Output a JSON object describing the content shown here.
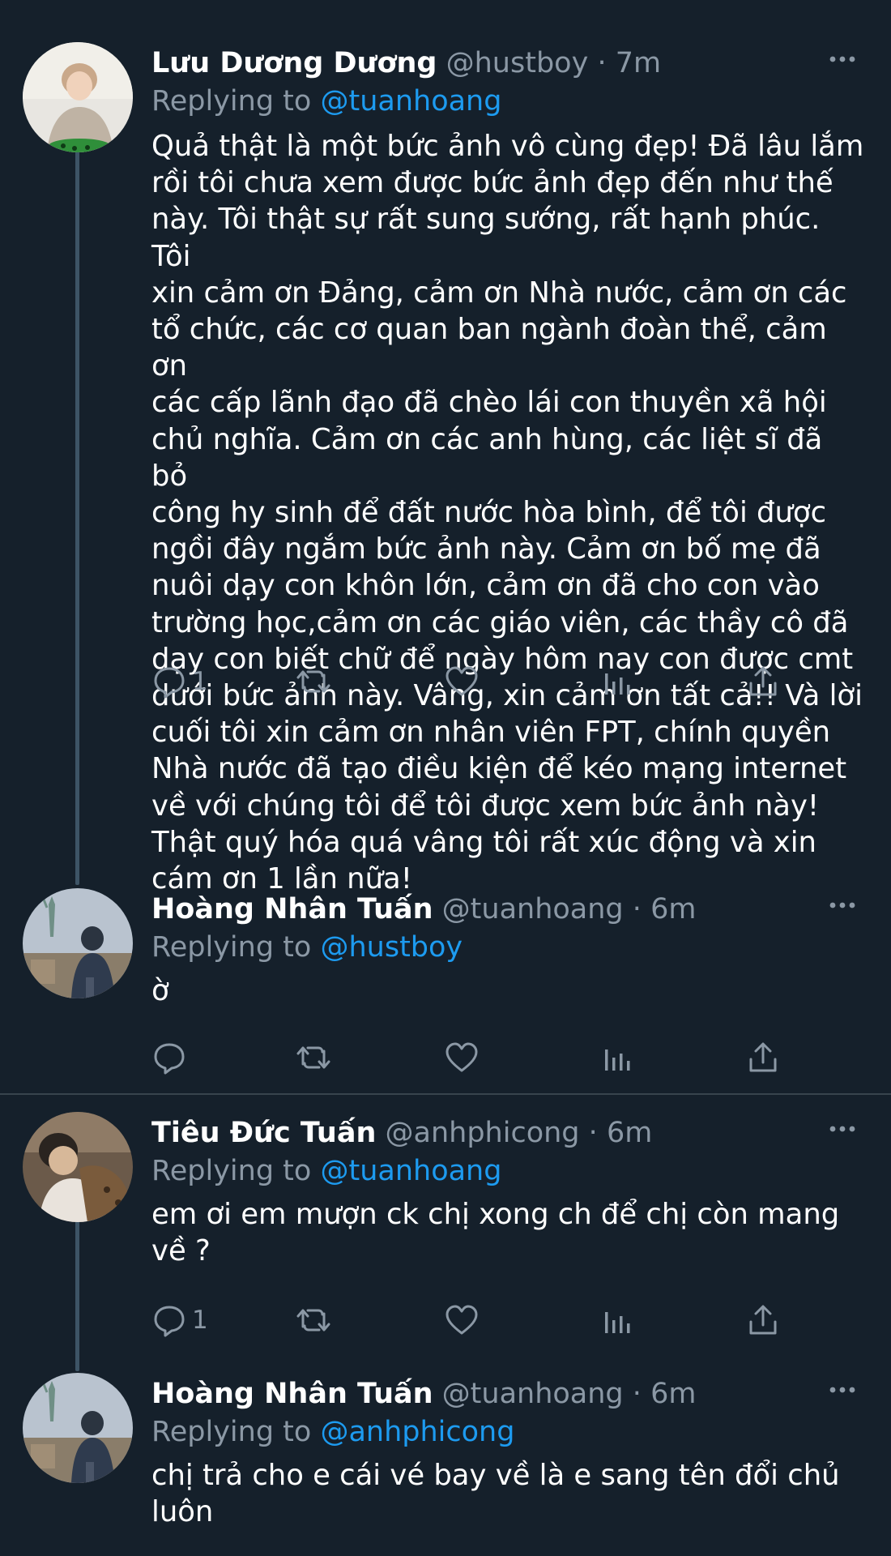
{
  "tweets": [
    {
      "name": "Lưu Dương Dương",
      "handle": "@hustboy",
      "separator": "·",
      "time": "7m",
      "replying_prefix": "Replying to",
      "replying_to": "@tuanhoang",
      "text": "Quả thật là một bức ảnh vô cùng đẹp! Đã lâu lắm\nrồi tôi chưa xem được bức ảnh đẹp đến như thế\nnày. Tôi thật sự rất sung sướng, rất hạnh phúc. Tôi\nxin cảm ơn Đảng, cảm ơn Nhà nước, cảm ơn các\ntổ chức, các cơ quan ban ngành đoàn thể, cảm ơn\ncác cấp lãnh đạo đã chèo lái con thuyền xã hội\nchủ nghĩa. Cảm ơn các anh hùng, các liệt sĩ đã bỏ\ncông hy sinh để đất nước hòa bình, để tôi được\nngồi đây ngắm bức ảnh này. Cảm ơn bố mẹ đã\nnuôi dạy con khôn lớn, cảm ơn đã cho con vào\ntrường học,cảm ơn các giáo viên, các thầy cô đã\ndạy con biết chữ để ngày hôm nay con được cmt\ndưới bức ảnh này. Vâng, xin cảm ơn tất cả!! Và lời\ncuối tôi xin cảm ơn nhân viên FPT, chính quyền\nNhà nước đã tạo điều kiện để kéo mạng internet\nvề với chúng tôi để tôi được xem bức ảnh này!\nThật quý hóa quá vâng tôi rất xúc động và xin\ncám ơn 1 lần nữa!",
      "reply_count": "1"
    },
    {
      "name": "Hoàng Nhân Tuấn",
      "handle": "@tuanhoang",
      "separator": "·",
      "time": "6m",
      "replying_prefix": "Replying to",
      "replying_to": "@hustboy",
      "text": "ờ",
      "reply_count": ""
    },
    {
      "name": "Tiêu Đức Tuấn",
      "handle": "@anhphicong",
      "separator": "·",
      "time": "6m",
      "replying_prefix": "Replying to",
      "replying_to": "@tuanhoang",
      "text": "em ơi em mượn ck chị xong ch để chị còn mang\nvề ?",
      "reply_count": "1"
    },
    {
      "name": "Hoàng Nhân Tuấn",
      "handle": "@tuanhoang",
      "separator": "·",
      "time": "6m",
      "replying_prefix": "Replying to",
      "replying_to": "@anhphicong",
      "text": "chị trả cho e cái vé bay về là e sang tên đổi chủ\nluôn",
      "reply_count": ""
    }
  ],
  "icons": {
    "reply": "reply-icon",
    "retweet": "retweet-icon",
    "like": "heart-icon",
    "views": "analytics-icon",
    "share": "share-icon",
    "more": "more-icon"
  },
  "colors": {
    "background": "#15202b",
    "secondary_text": "#8b98a5",
    "link": "#1d9bf0",
    "divider": "#38444d",
    "thread_line": "#3d5466"
  }
}
